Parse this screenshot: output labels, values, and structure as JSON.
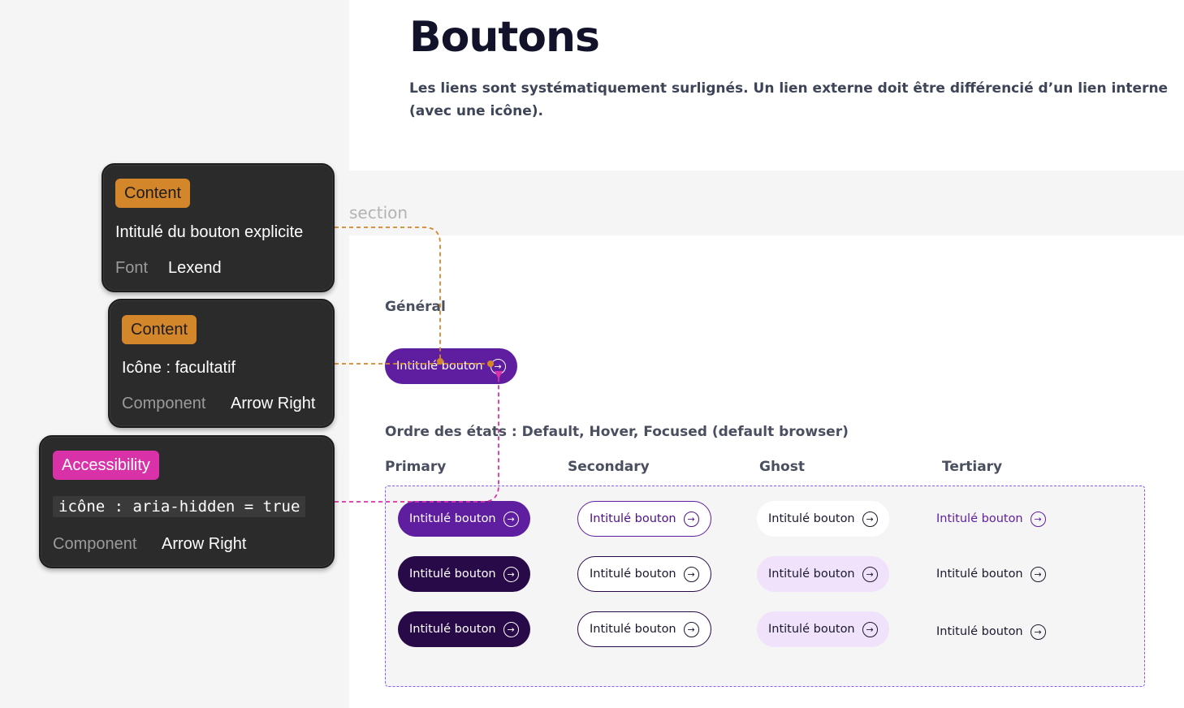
{
  "page": {
    "title": "Boutons",
    "description": "Les liens sont systématiquement surlignés. Un lien externe doit être différencié d’un lien interne (avec une icône).",
    "section_label": "section",
    "general_heading": "Général",
    "states_heading": "Ordre des états : Default, Hover, Focused (default browser)"
  },
  "general_button": {
    "label": "Intitulé bouton",
    "icon": "arrow-right-circle-icon"
  },
  "columns": [
    "Primary",
    "Secondary",
    "Ghost",
    "Tertiary"
  ],
  "variant_button_label": "Intitulé bouton",
  "annotations": [
    {
      "tag": "Content",
      "text": "Intitulé du bouton explicite",
      "key": "Font",
      "value": "Lexend"
    },
    {
      "tag": "Content",
      "text": "Icône : facultatif",
      "key": "Component",
      "value": "Arrow Right"
    },
    {
      "tag": "Accessibility",
      "code": "icône : aria-hidden = true",
      "key": "Component",
      "value": "Arrow Right"
    }
  ],
  "colors": {
    "primary": "#5f1ea0",
    "primary_dark": "#280a48",
    "ghost_hover": "#f0e2fb",
    "content_tag": "#d4862b",
    "accessibility_tag": "#d932a8",
    "frame_border": "#8a5cf0"
  }
}
